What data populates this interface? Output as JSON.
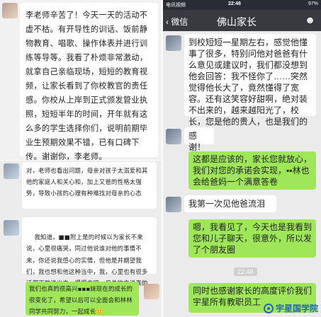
{
  "panel1": {
    "note": "李老师辛苦了！今天一天的活动不虚不枯。有开导性的训话、饭前静物教育、唱歌、操作体表并进行训练等导等。我看了朴烦非常激动，就拿自己亲临现场，短短的教育视频，让家长看到了你校教官的责任感。你校从上岸到正式颁发管业执照，短短半年的时间，开年就有这么多的学生选择你们，说明前期毕业生预期效果不错，已有口碑下传。谢谢你，李老师。"
  },
  "panel2": {
    "note1": "对，老师也看出问题，母亲对孩子太溺爱和其他的家庭人和关心和，加上又爸的性格太强势，导致小孩的心理有种难找对母亲的心态",
    "note2": "我知道，■■附上是的时候以为家长不来说，心里很痛哭，同过他说谁对他的事情不来，你还说我感心的实情，但他是并期望我们，我也想和他这种当中，我，心里也有很多话都不敢说出来，慢慢来吧，但总的来说真的感谢老师们",
    "emoji": "🙂🙂🙂",
    "reply": "我们也真的很高兴▪▪▪妹现在的成长的很变化了，希望以后可以全面会和林林同学共同努力，一起成长🙂"
  },
  "status": {
    "left": "电讯视频",
    "time": "22:48",
    "battery": "97%"
  },
  "header": {
    "back": "微信",
    "title": "佛山家长"
  },
  "chat": [
    {
      "side": "left",
      "text": "到校短短一星期左右，感觉他懂事了很多，特别问他对爸爸有什么意见或建议时，我们都没想到他会回答：我不怪你了……突然觉得他长大了，竟然懂得了宽容。还有这笑容好甜啊，绝对装不出来的，越来越阳光了，校长，您是他的贵人，也是我们的贵人！"
    },
    {
      "side": "left",
      "text": "感谢！"
    },
    {
      "side": "right",
      "text": "这都是应该的，家长您就放心，我们对您的承诺会实现，▪▪林也会给爸妈一个满意答卷"
    },
    {
      "side": "left",
      "text": "我第一次见他爸流泪"
    },
    {
      "side": "right",
      "text": "嗯，我看见了，今天也是我看到您和儿子聊天，很意外，所以发了个朋友圈"
    },
    {
      "side": "right",
      "text": "同时也感谢家长的高度评价我们宇星所有教职员工"
    }
  ],
  "timestamp": "22:48",
  "watermark": "宇星国学院"
}
